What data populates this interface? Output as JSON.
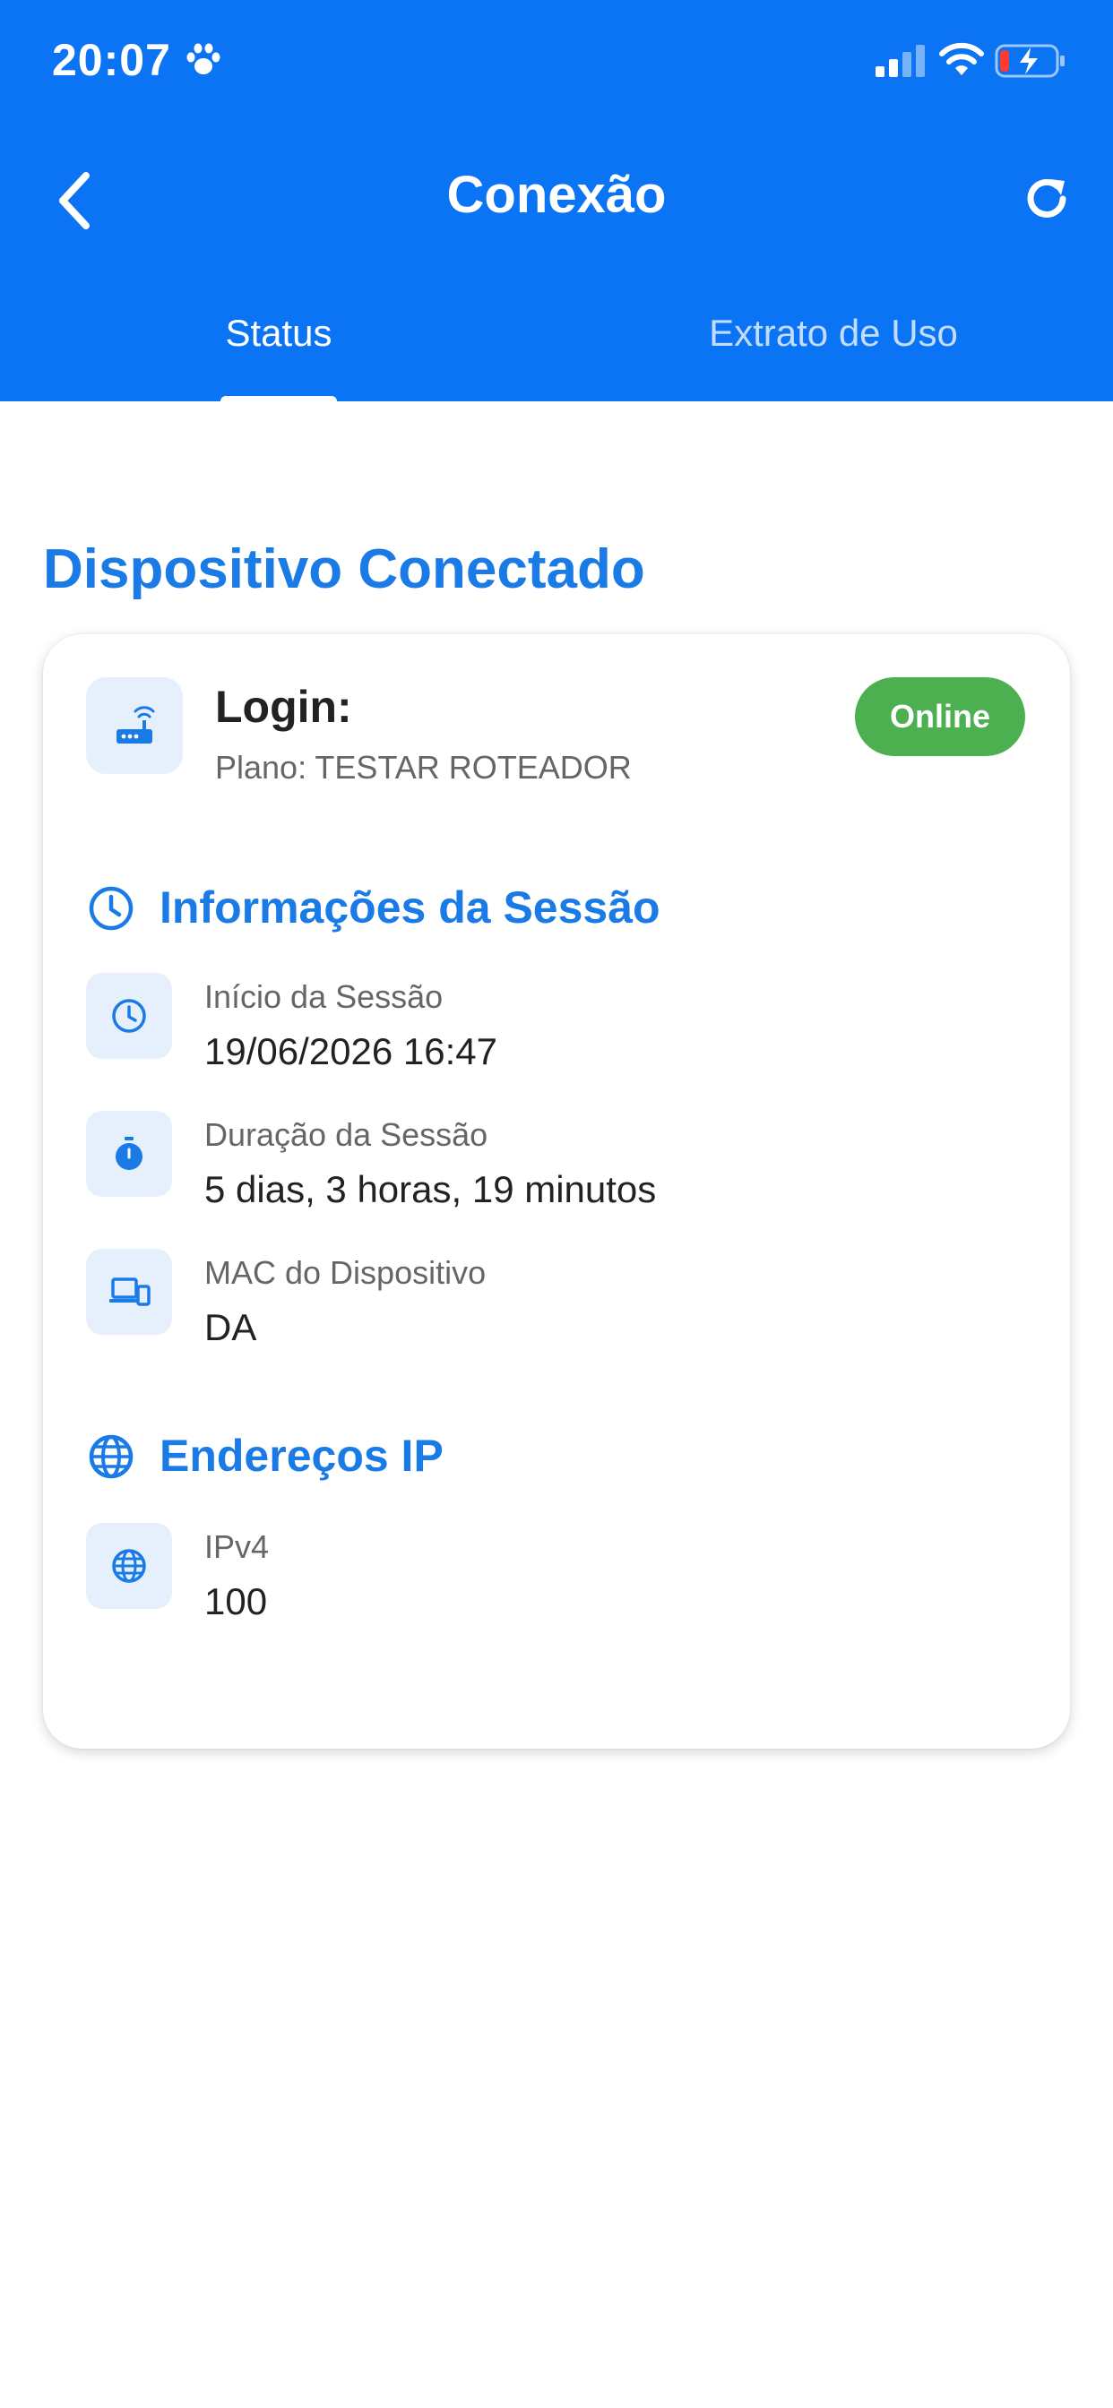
{
  "status_bar": {
    "time": "20:07",
    "icons": [
      "paw-icon",
      "signal-icon",
      "wifi-icon",
      "battery-charging-icon"
    ]
  },
  "header": {
    "title": "Conexão",
    "back_icon": "chevron-left-icon",
    "refresh_icon": "refresh-icon",
    "bg_color": "#0a74f5"
  },
  "tabs": [
    {
      "label": "Status",
      "active": true
    },
    {
      "label": "Extrato de Uso",
      "active": false
    }
  ],
  "section_title": "Dispositivo Conectado",
  "device": {
    "icon": "router-icon",
    "login_label": "Login:",
    "plan": "Plano: TESTAR ROTEADOR",
    "status": "Online",
    "status_color": "#4caf50"
  },
  "session": {
    "title": "Informações da Sessão",
    "icon": "clock-icon",
    "items": [
      {
        "label": "Início da Sessão",
        "value": "19/06/2026 16:47",
        "icon": "clock-icon"
      },
      {
        "label": "Duração da Sessão",
        "value": "5 dias, 3 horas, 19 minutos",
        "icon": "stopwatch-icon"
      },
      {
        "label": "MAC do Dispositivo",
        "value": "DA",
        "icon": "devices-icon"
      }
    ]
  },
  "ip": {
    "title": "Endereços IP",
    "icon": "globe-icon",
    "items": [
      {
        "label": "IPv4",
        "value": "100",
        "icon": "globe-icon"
      }
    ]
  },
  "accent_color": "#1a7ae6"
}
